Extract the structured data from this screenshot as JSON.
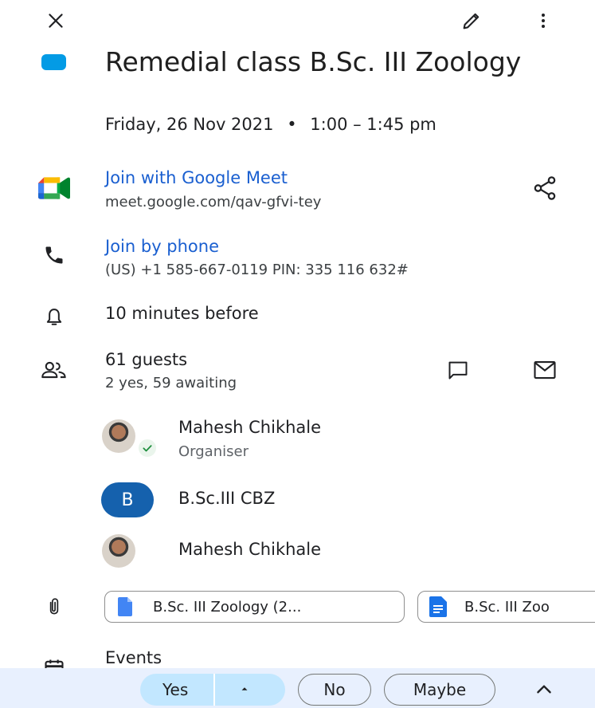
{
  "toolbar": {
    "close_icon": "close-icon",
    "edit_icon": "pencil-icon",
    "more_icon": "more-vert-icon"
  },
  "event": {
    "color": "#039be5",
    "title": "Remedial class B.Sc. III Zoology",
    "date": "Friday, 26 Nov 2021",
    "separator": "•",
    "time": "1:00 – 1:45 pm"
  },
  "meet": {
    "label": "Join with Google Meet",
    "url": "meet.google.com/qav-gfvi-tey"
  },
  "phone": {
    "label": "Join by phone",
    "details": "(US) +1 585-667-0119 PIN: 335 116 632#"
  },
  "reminder": {
    "text": "10 minutes before"
  },
  "guests": {
    "count_label": "61 guests",
    "summary": "2 yes, 59 awaiting",
    "list": [
      {
        "name": "Mahesh Chikhale",
        "role": "Organiser"
      },
      {
        "name": "B.Sc.III CBZ",
        "initial": "B"
      },
      {
        "name": "Mahesh Chikhale"
      }
    ]
  },
  "attachments": [
    {
      "label": "B.Sc. III Zoology  (2..."
    },
    {
      "label": "B.Sc. III Zoo"
    }
  ],
  "calendar": {
    "label": "Events"
  },
  "rsvp": {
    "yes": "Yes",
    "no": "No",
    "maybe": "Maybe"
  },
  "colors": {
    "accent_blue": "#1a5fd0",
    "rsvp_bar": "#e8f0fe",
    "yes_pill": "#c2e7ff"
  }
}
